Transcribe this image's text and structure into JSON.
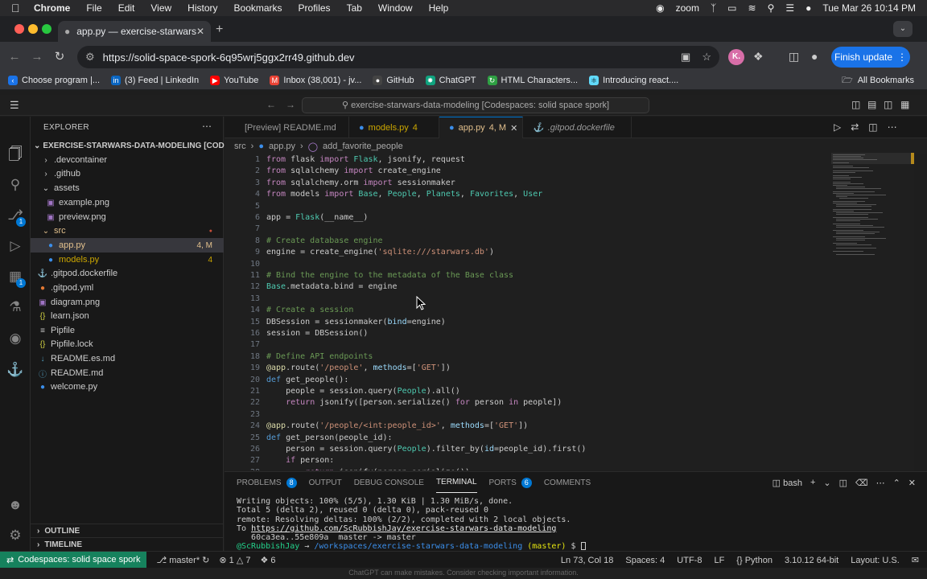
{
  "mac_menu": {
    "app": "Chrome",
    "items": [
      "File",
      "Edit",
      "View",
      "History",
      "Bookmarks",
      "Profiles",
      "Tab",
      "Window",
      "Help"
    ],
    "zoom": "zoom",
    "datetime": "Tue Mar 26  10:14 PM"
  },
  "browser": {
    "tab_title": "app.py — exercise-starwars-",
    "url": "https://solid-space-spork-6q95wrj5ggx2rr49.github.dev",
    "avatar": "K.",
    "finish_update": "Finish update",
    "bookmarks": [
      {
        "label": "Choose program |...",
        "icon": "chevron-icon",
        "color": "#1a73e8"
      },
      {
        "label": "(3) Feed | LinkedIn",
        "icon": "linkedin-icon",
        "color": "#0a66c2"
      },
      {
        "label": "YouTube",
        "icon": "youtube-icon",
        "color": "#ff0000"
      },
      {
        "label": "Inbox (38,001) - jv...",
        "icon": "gmail-icon",
        "color": "#ea4335"
      },
      {
        "label": "GitHub",
        "icon": "github-icon",
        "color": "#444444"
      },
      {
        "label": "ChatGPT",
        "icon": "chatgpt-icon",
        "color": "#10a37f"
      },
      {
        "label": "HTML Characters...",
        "icon": "html-icon",
        "color": "#2ea043"
      },
      {
        "label": "Introducing react....",
        "icon": "react-icon",
        "color": "#61dafb"
      }
    ],
    "all_bookmarks": "All Bookmarks"
  },
  "vscode": {
    "command_center": "exercise-starwars-data-modeling [Codespaces: solid space spork]",
    "explorer": {
      "title": "EXPLORER",
      "root": "EXERCISE-STARWARS-DATA-MODELING [CODE...",
      "items": [
        {
          "label": ".devcontainer",
          "type": "folder",
          "status": ""
        },
        {
          "label": ".github",
          "type": "folder",
          "status": ""
        },
        {
          "label": "assets",
          "type": "folder-open",
          "status": ""
        },
        {
          "label": "example.png",
          "type": "image",
          "status": ""
        },
        {
          "label": "preview.png",
          "type": "image",
          "status": ""
        },
        {
          "label": "src",
          "type": "folder-open",
          "status": "●"
        },
        {
          "label": "app.py",
          "type": "python",
          "status": "4, M"
        },
        {
          "label": "models.py",
          "type": "python",
          "status": "4"
        },
        {
          "label": ".gitpod.dockerfile",
          "type": "docker",
          "status": ""
        },
        {
          "label": ".gitpod.yml",
          "type": "yaml",
          "status": ""
        },
        {
          "label": "diagram.png",
          "type": "image",
          "status": ""
        },
        {
          "label": "learn.json",
          "type": "json",
          "status": ""
        },
        {
          "label": "Pipfile",
          "type": "file",
          "status": ""
        },
        {
          "label": "Pipfile.lock",
          "type": "json",
          "status": ""
        },
        {
          "label": "README.es.md",
          "type": "markdown",
          "status": ""
        },
        {
          "label": "README.md",
          "type": "info",
          "status": ""
        },
        {
          "label": "welcome.py",
          "type": "python",
          "status": ""
        }
      ],
      "outline": "OUTLINE",
      "timeline": "TIMELINE"
    },
    "tabs": [
      {
        "label": "[Preview] README.md",
        "status": ""
      },
      {
        "label": "models.py",
        "status": "4"
      },
      {
        "label": "app.py",
        "status": "4, M"
      },
      {
        "label": ".gitpod.dockerfile",
        "status": ""
      }
    ],
    "breadcrumb": [
      "src",
      "app.py",
      "add_favorite_people"
    ],
    "code_lines": [
      "from flask import Flask, jsonify, request",
      "from sqlalchemy import create_engine",
      "from sqlalchemy.orm import sessionmaker",
      "from models import Base, People, Planets, Favorites, User",
      "",
      "app = Flask(__name__)",
      "",
      "# Create database engine",
      "engine = create_engine('sqlite:///starwars.db')",
      "",
      "# Bind the engine to the metadata of the Base class",
      "Base.metadata.bind = engine",
      "",
      "# Create a session",
      "DBSession = sessionmaker(bind=engine)",
      "session = DBSession()",
      "",
      "# Define API endpoints",
      "@app.route('/people', methods=['GET'])",
      "def get_people():",
      "    people = session.query(People).all()",
      "    return jsonify([person.serialize() for person in people])",
      "",
      "@app.route('/people/<int:people_id>', methods=['GET'])",
      "def get_person(people_id):",
      "    person = session.query(People).filter_by(id=people_id).first()",
      "    if person:",
      "        return jsonify(person.serialize())"
    ],
    "panel": {
      "tabs": [
        {
          "label": "PROBLEMS",
          "badge": "8"
        },
        {
          "label": "OUTPUT",
          "badge": ""
        },
        {
          "label": "DEBUG CONSOLE",
          "badge": ""
        },
        {
          "label": "TERMINAL",
          "badge": ""
        },
        {
          "label": "PORTS",
          "badge": "6"
        },
        {
          "label": "COMMENTS",
          "badge": ""
        }
      ],
      "shell": "bash",
      "terminal": {
        "line1": "Writing objects: 100% (5/5), 1.30 KiB | 1.30 MiB/s, done.",
        "line2": "Total 5 (delta 2), reused 0 (delta 0), pack-reused 0",
        "line3": "remote: Resolving deltas: 100% (2/2), completed with 2 local objects.",
        "line4_prefix": "To ",
        "line4_link": "https://github.com/ScRubbishJay/exercise-starwars-data-modeling",
        "line5": "   60ca3ea..55e809a  master -> master",
        "prompt_user": "@ScRubbishJay",
        "prompt_arrow": " → ",
        "prompt_path": "/workspaces/exercise-starwars-data-modeling",
        "prompt_branch": "(master)",
        "prompt_end": " $ "
      }
    },
    "status": {
      "remote": "Codespaces: solid space spork",
      "branch": "master*",
      "errors": "1",
      "warnings": "7",
      "ports": "6",
      "position": "Ln 73, Col 18",
      "spaces": "Spaces: 4",
      "encoding": "UTF-8",
      "eol": "LF",
      "language": "Python",
      "interpreter": "3.10.12 64-bit",
      "layout": "Layout: U.S."
    }
  },
  "footer": "ChatGPT can make mistakes. Consider checking important information."
}
